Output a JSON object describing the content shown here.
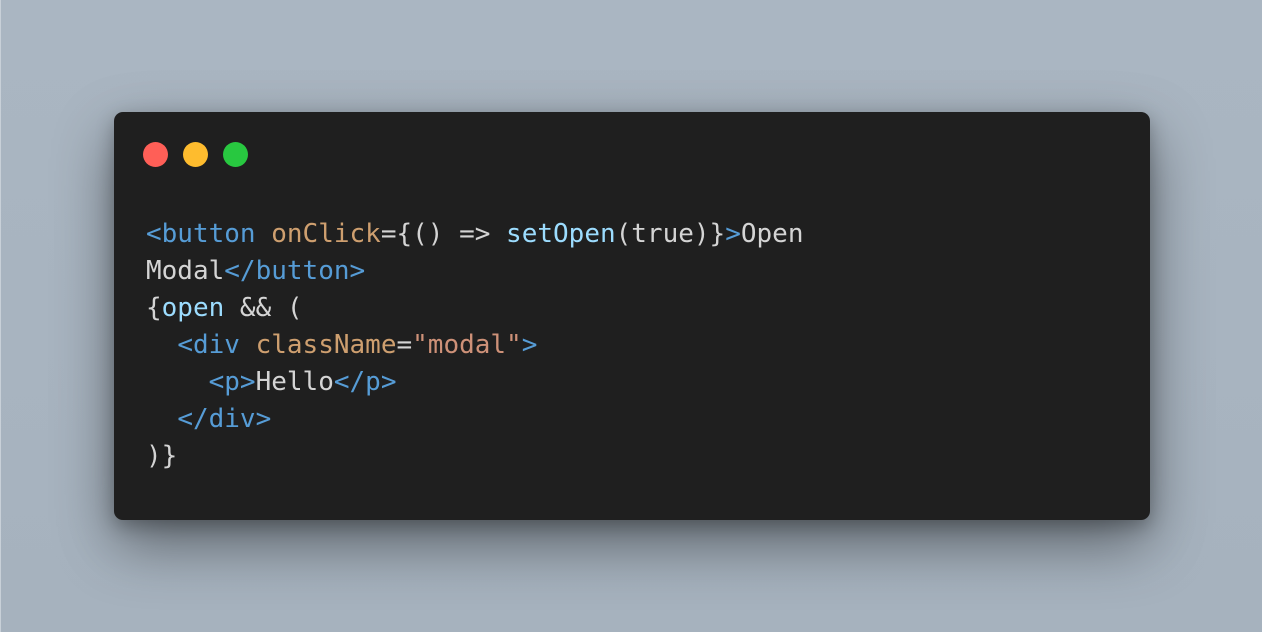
{
  "window": {
    "controls": {
      "close_color": "#ff5f57",
      "minimize_color": "#febc2e",
      "maximize_color": "#28c840"
    }
  },
  "code": {
    "lines": [
      [
        {
          "t": "<button",
          "k": "tag"
        },
        {
          "t": " ",
          "k": "plain"
        },
        {
          "t": "onClick",
          "k": "attr"
        },
        {
          "t": "={() => ",
          "k": "plain"
        },
        {
          "t": "setOpen",
          "k": "fn"
        },
        {
          "t": "(true)}",
          "k": "plain"
        },
        {
          "t": ">",
          "k": "tag"
        },
        {
          "t": "Open",
          "k": "plain"
        }
      ],
      [
        {
          "t": "Modal",
          "k": "plain"
        },
        {
          "t": "</button>",
          "k": "tag"
        }
      ],
      [
        {
          "t": "{",
          "k": "plain"
        },
        {
          "t": "open",
          "k": "fn"
        },
        {
          "t": " && (",
          "k": "plain"
        }
      ],
      [
        {
          "t": "  ",
          "k": "plain"
        },
        {
          "t": "<div",
          "k": "tag"
        },
        {
          "t": " ",
          "k": "plain"
        },
        {
          "t": "className",
          "k": "attr"
        },
        {
          "t": "=",
          "k": "plain"
        },
        {
          "t": "\"modal\"",
          "k": "str"
        },
        {
          "t": ">",
          "k": "tag"
        }
      ],
      [
        {
          "t": "    ",
          "k": "plain"
        },
        {
          "t": "<p>",
          "k": "tag"
        },
        {
          "t": "Hello",
          "k": "plain"
        },
        {
          "t": "</p>",
          "k": "tag"
        }
      ],
      [
        {
          "t": "  ",
          "k": "plain"
        },
        {
          "t": "</div>",
          "k": "tag"
        }
      ],
      [
        {
          "t": ")}",
          "k": "plain"
        }
      ]
    ]
  }
}
